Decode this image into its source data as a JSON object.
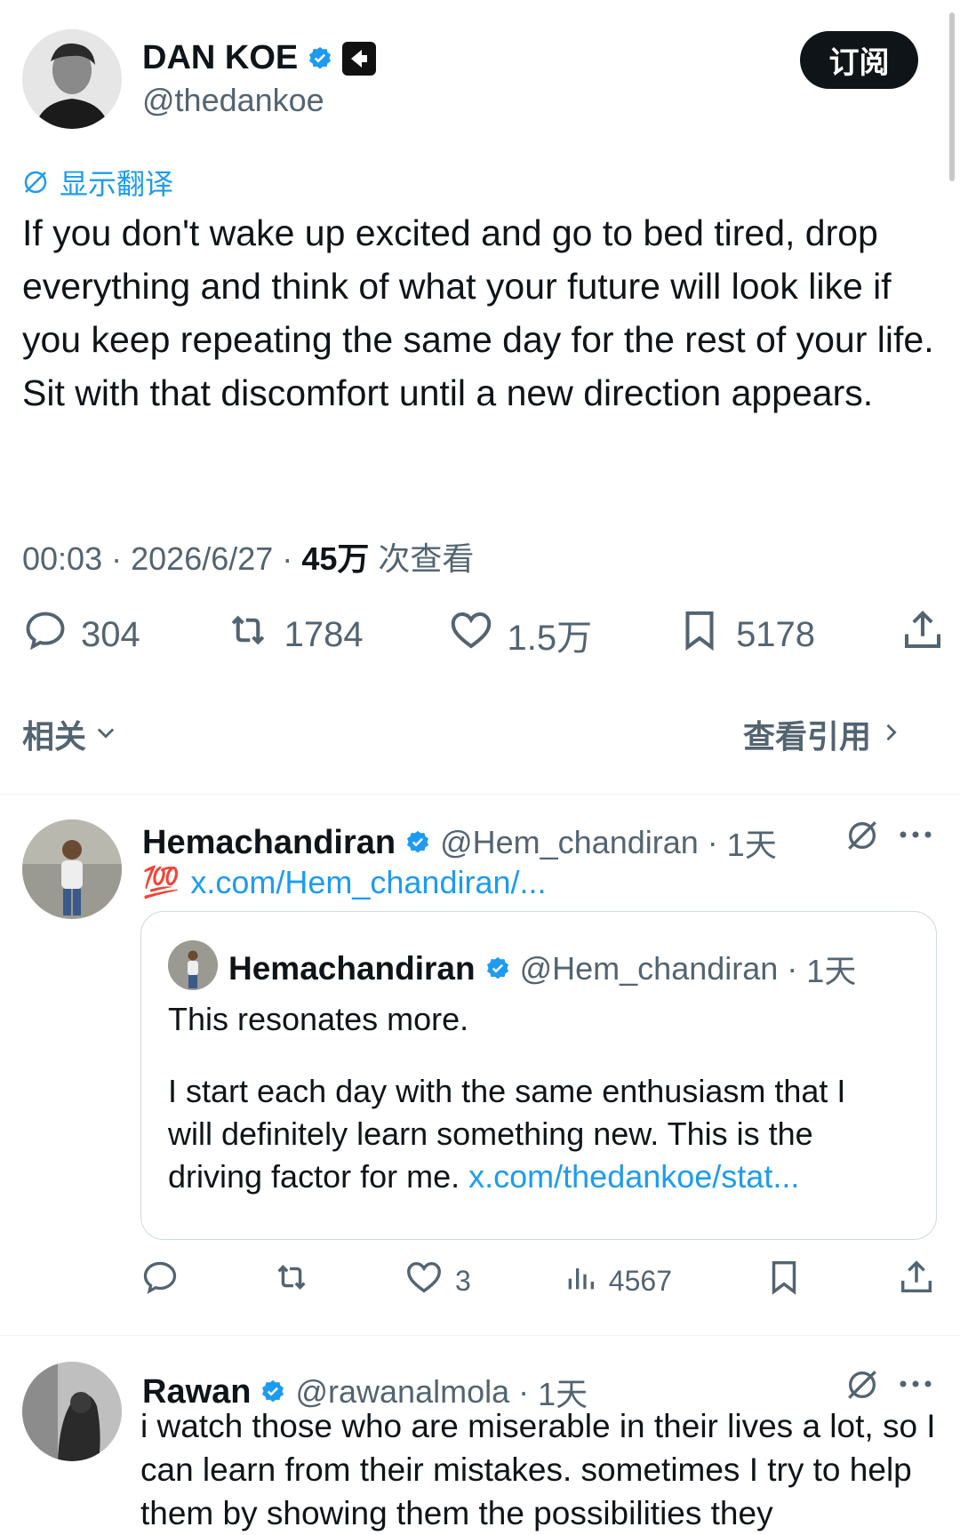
{
  "post": {
    "author_name": "DAN KOE",
    "author_handle": "@thedankoe",
    "subscribe_label": "订阅",
    "translate_label": "显示翻译",
    "text": "If you don't wake up excited and go to bed tired, drop everything and think of what your future will look like if you keep repeating the same day for the rest of your life. Sit with that discomfort until a new direction appears.",
    "time": "00:03",
    "dot1": "·",
    "date": "2026/6/27",
    "dot2": "·",
    "views_count": "45万",
    "views_label": "次查看",
    "stats": {
      "replies": "304",
      "reposts": "1784",
      "likes": "1.5万",
      "bookmarks": "5178"
    },
    "related_label": "相关",
    "view_quotes_label": "查看引用"
  },
  "reply1": {
    "name": "Hemachandiran",
    "handle": "@Hem_chandiran",
    "sep": "·",
    "age": "1天",
    "emoji": "💯",
    "link": "x.com/Hem_chandiran/...",
    "quote": {
      "name": "Hemachandiran",
      "handle": "@Hem_chandiran",
      "sep": "·",
      "age": "1天",
      "line1": "This resonates more.",
      "body": "I start each day with the same enthusiasm that I will definitely learn something new. This is the driving factor for me.",
      "link": "x.com/thedankoe/stat..."
    },
    "stats": {
      "likes": "3",
      "views": "4567"
    }
  },
  "reply2": {
    "name": "Rawan",
    "handle": "@rawanalmola",
    "sep": "·",
    "age": "1天",
    "text": "i watch those who are miserable in their lives a lot, so I can learn from their mistakes. sometimes I try to help them by showing them the possibilities they"
  },
  "colors": {
    "accent": "#1d9bf0",
    "text": "#0f1419",
    "muted": "#536471",
    "border": "#cfd9de"
  }
}
